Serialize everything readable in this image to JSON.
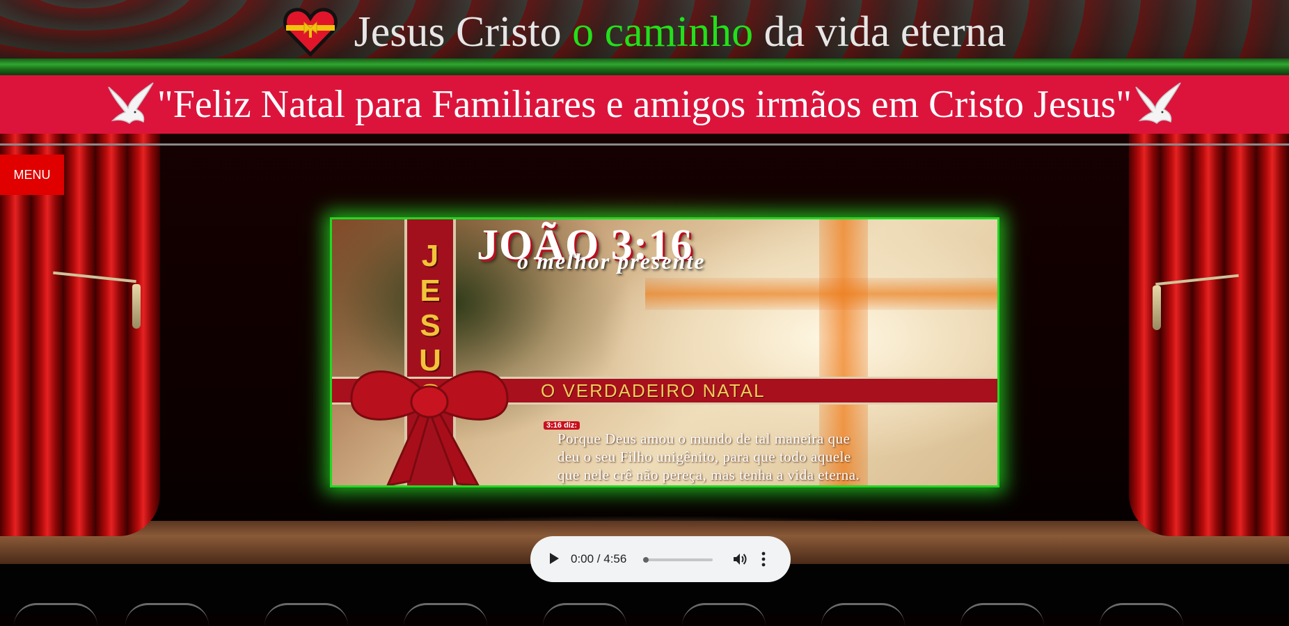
{
  "site": {
    "title_part1": "Jesus Cristo ",
    "title_part2": "o caminho",
    "title_part3": " da vida eterna",
    "title_accent_color": "#22e01a",
    "heart_icon": "heart-gift-icon"
  },
  "banner": {
    "text": "\"Feliz Natal para Familiares e amigos irmãos em Cristo Jesus\"",
    "background_color": "#dc143c",
    "dove_icon": "dove-icon"
  },
  "menu": {
    "label": "MENU",
    "color": "#e00000"
  },
  "featured_card": {
    "heading": "JOÃO 3:16",
    "subheading": "o melhor presente",
    "ribbon_word_letters": [
      "J",
      "E",
      "S",
      "U",
      "S"
    ],
    "band_text": "O VERDADEIRO NATAL",
    "verse_ref": "3:16 diz:",
    "verse_lines": [
      "Porque Deus amou o mundo de tal maneira que",
      "deu o seu Filho unigênito, para que todo aquele",
      "que nele crê não pereça, mas tenha a vida eterna."
    ],
    "border_color": "#22d822"
  },
  "audio": {
    "time_display": "0:00 / 4:56",
    "current_time": "0:00",
    "duration": "4:56",
    "progress": 0,
    "play_icon": "play-icon",
    "volume_icon": "volume-icon",
    "more_icon": "more-options-icon"
  }
}
